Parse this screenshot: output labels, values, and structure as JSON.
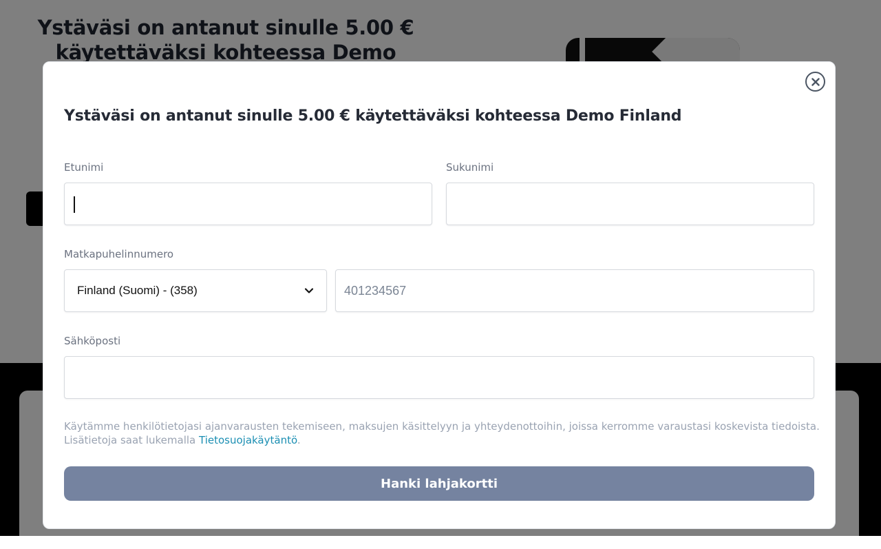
{
  "background": {
    "title": "Ystäväsi on antanut sinulle 5.00 € käytettäväksi kohteessa Demo"
  },
  "modal": {
    "title": "Ystäväsi on antanut sinulle 5.00 € käytettäväksi kohteessa Demo Finland",
    "close_icon": "close-circle-icon",
    "fields": {
      "first_name": {
        "label": "Etunimi",
        "value": ""
      },
      "last_name": {
        "label": "Sukunimi",
        "value": ""
      },
      "phone": {
        "label": "Matkapuhelinnumero",
        "country": "Finland (Suomi) - (358)",
        "placeholder": "401234567",
        "value": ""
      },
      "email": {
        "label": "Sähköposti",
        "value": ""
      }
    },
    "disclaimer": {
      "text": "Käytämme henkilötietojasi ajanvarausten tekemiseen, maksujen käsittelyyn ja yhteydenottoihin, joissa kerromme varaustasi koskevista tiedoista. Lisätietoja saat lukemalla ",
      "link": "Tietosuojakäytäntö",
      "suffix": "."
    },
    "submit_label": "Hanki lahjakortti"
  },
  "colors": {
    "overlay": "rgba(0,0,0,0.5)",
    "submit": "#7583a0",
    "link": "#1c8fb3"
  }
}
